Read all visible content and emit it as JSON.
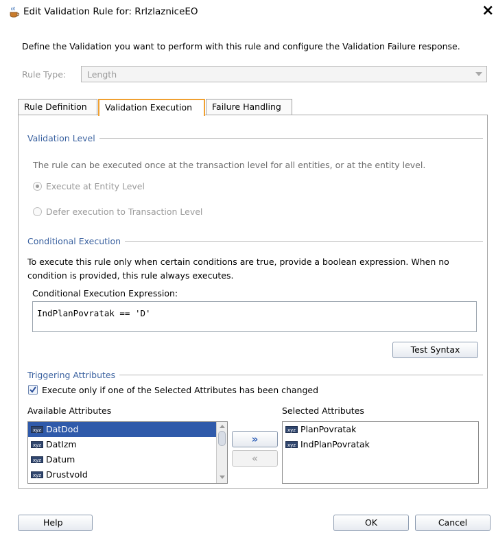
{
  "window": {
    "title": "Edit Validation Rule for: RrIzlazniceEO",
    "close_glyph": "×"
  },
  "description": "Define the Validation you want to perform with this rule and configure the Validation Failure response.",
  "rule_type": {
    "label": "Rule Type:",
    "value": "Length"
  },
  "tabs": [
    {
      "label": "Rule Definition",
      "active": false
    },
    {
      "label": "Validation Execution",
      "active": true
    },
    {
      "label": "Failure Handling",
      "active": false
    }
  ],
  "validation_level": {
    "title": "Validation Level",
    "text": "The rule can be executed once at the transaction level for all entities, or at the entity level.",
    "option_entity": "Execute at Entity Level",
    "option_transaction": "Defer execution to Transaction Level",
    "selected": "entity"
  },
  "conditional_execution": {
    "title": "Conditional Execution",
    "text_line1": "To execute this rule only when certain conditions are true, provide a boolean expression. When no",
    "text_line2": "condition is provided, this rule always executes.",
    "expression_label": "Conditional Execution Expression:",
    "expression": "IndPlanPovratak == 'D'",
    "test_syntax_label": "Test Syntax"
  },
  "triggering_attributes": {
    "title": "Triggering Attributes",
    "checkbox_label": "Execute only if one of the Selected Attributes has been changed",
    "checked": true,
    "available_label": "Available Attributes",
    "selected_label": "Selected Attributes",
    "available": [
      "DatDod",
      "DatIzm",
      "Datum",
      "DrustvoId"
    ],
    "available_selected_index": 0,
    "selected": [
      "PlanPovratak",
      "IndPlanPovratak"
    ],
    "attr_badge": "xyz",
    "move_right_glyph": "»",
    "move_left_glyph": "«"
  },
  "footer": {
    "help_label": "Help",
    "ok_label": "OK",
    "cancel_label": "Cancel"
  },
  "colors": {
    "section_title": "#3b62a0",
    "active_tab_border": "#f0a030",
    "list_selection": "#2f5aaa"
  }
}
